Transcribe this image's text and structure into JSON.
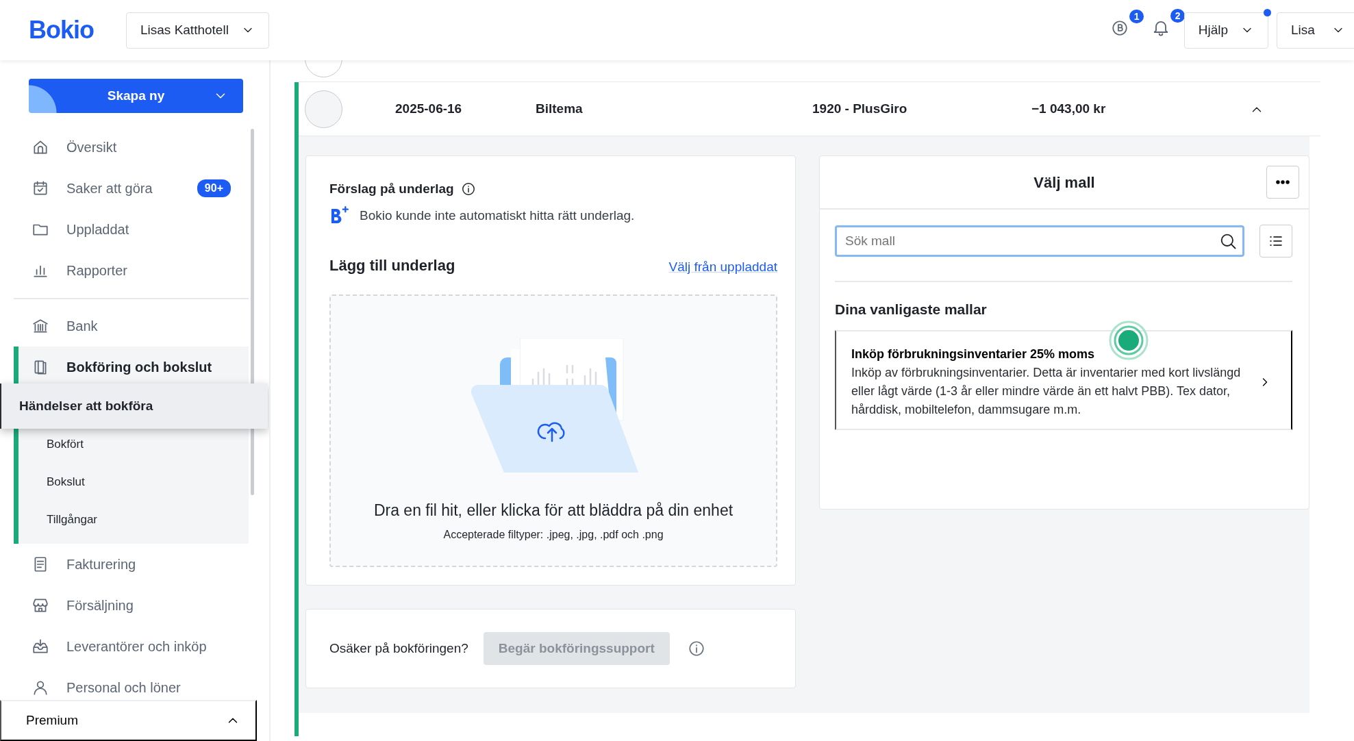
{
  "header": {
    "logo": "Bokio",
    "company": "Lisas Katthotell",
    "notifications": [
      {
        "kind": "coin",
        "count": "1"
      },
      {
        "kind": "bell",
        "count": "2"
      }
    ],
    "help": "Hjälp",
    "help_dot": true,
    "user": "Lisa"
  },
  "sidebar": {
    "create_button": "Skapa ny",
    "items": [
      {
        "kind": "home",
        "label": "Översikt",
        "selected": false
      },
      {
        "kind": "calendar",
        "label": "Saker att göra",
        "badge": "90+",
        "selected": false
      },
      {
        "kind": "folder",
        "label": "Uppladdat",
        "selected": false
      },
      {
        "kind": "chart",
        "label": "Rapporter",
        "selected": false,
        "divider_after": true
      },
      {
        "kind": "bank",
        "label": "Bank",
        "selected": false
      },
      {
        "kind": "book",
        "label": "Bokföring och bokslut",
        "selected": true,
        "expanded": true,
        "children": [
          {
            "label": "Händelser att bokföra",
            "selected": true
          },
          {
            "label": "Bokfört",
            "selected": false
          },
          {
            "label": "Bokslut",
            "selected": false
          },
          {
            "label": "Tillgångar",
            "selected": false
          }
        ]
      },
      {
        "kind": "invoice",
        "label": "Fakturering",
        "selected": false
      },
      {
        "kind": "store",
        "label": "Försäljning",
        "selected": false
      },
      {
        "kind": "inbox",
        "label": "Leverantörer och inköp",
        "selected": false
      },
      {
        "kind": "person",
        "label": "Personal och löner",
        "selected": false
      }
    ],
    "footer": {
      "label": "Premium",
      "expanded": false
    }
  },
  "transaction": {
    "date": "2025-06-16",
    "description": "Biltema",
    "account": "1920 - PlusGiro",
    "amount": "−1 043,00 kr",
    "expanded": true
  },
  "suggestion": {
    "title": "Förslag på underlag",
    "message": "Bokio kunde inte automatiskt hitta rätt underlag."
  },
  "attachment": {
    "title": "Lägg till underlag",
    "link": "Välj från uppladdat",
    "drop_text": "Dra en fil hit, eller klicka för att bläddra på din enhet",
    "file_types": "Accepterade filtyper: .jpeg, .jpg, .pdf och .png"
  },
  "support": {
    "question": "Osäker på bokföringen?",
    "button": "Begär bokföringssupport",
    "disabled": true
  },
  "templates": {
    "title": "Välj mall",
    "search_placeholder": "Sök mall",
    "section_title": "Dina vanligaste mallar",
    "items": [
      {
        "title": "Inköp förbrukningsinventarier 25% moms",
        "description": "Inköp av förbrukningsinventarier. Detta är inventarier med kort livslängd eller lågt värde (1-3 år eller mindre värde än ett halvt PBB). Tex dator, hårddisk, mobiltelefon, dammsugare m.m.",
        "highlighted": true
      }
    ]
  }
}
